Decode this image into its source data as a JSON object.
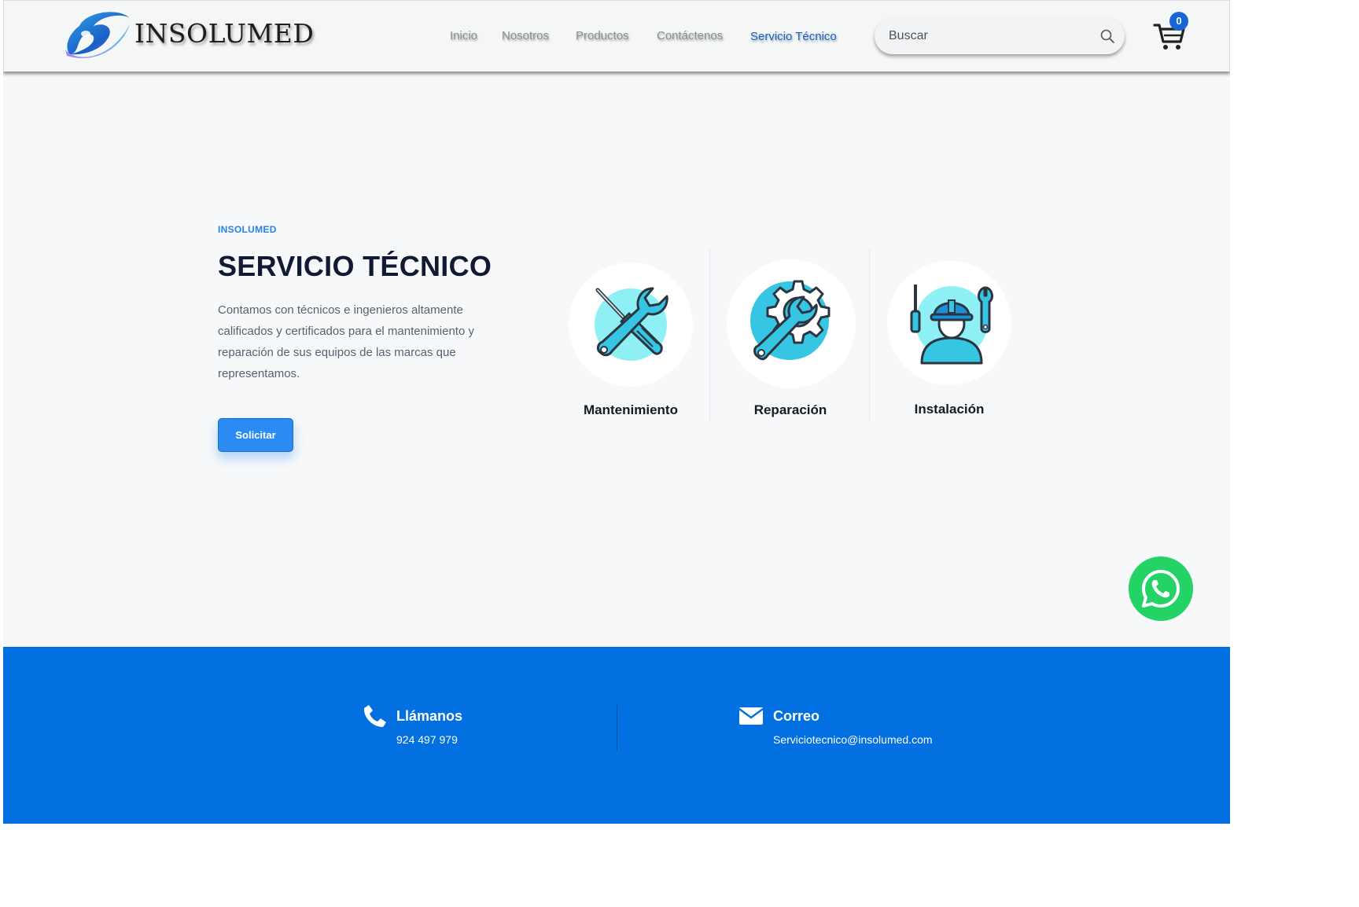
{
  "header": {
    "brand": "INSOLUMED",
    "nav": [
      {
        "label": "Inicio",
        "active": false
      },
      {
        "label": "Nosotros",
        "active": false
      },
      {
        "label": "Productos",
        "active": false
      },
      {
        "label": "Contáctenos",
        "active": false
      },
      {
        "label": "Servicio Técnico",
        "active": true
      }
    ],
    "search": {
      "placeholder": "Buscar",
      "value": ""
    },
    "cart": {
      "count": "0"
    }
  },
  "hero": {
    "eyebrow": "INSOLUMED",
    "title": "SERVICIO TÉCNICO",
    "description": "Contamos con técnicos e ingenieros altamente calificados y certificados para el mantenimiento y reparación de sus equipos de las marcas que representamos.",
    "button_label": "Solicitar"
  },
  "services": [
    {
      "label": "Mantenimiento",
      "icon": "tools-icon"
    },
    {
      "label": "Reparación",
      "icon": "gear-wrench-icon"
    },
    {
      "label": "Instalación",
      "icon": "technician-icon"
    }
  ],
  "footer": {
    "phone": {
      "title": "Llámanos",
      "value": "924 497 979",
      "icon": "phone-icon"
    },
    "email": {
      "title": "Correo",
      "value": "Serviciotecnico@insolumed.com",
      "icon": "envelope-icon"
    }
  },
  "colors": {
    "accent": "#2b8bf2",
    "nav_active": "#1560c9",
    "footer_bg": "#0270e0",
    "whatsapp": "#23d366",
    "icon_cyan": "#36c6e3"
  }
}
